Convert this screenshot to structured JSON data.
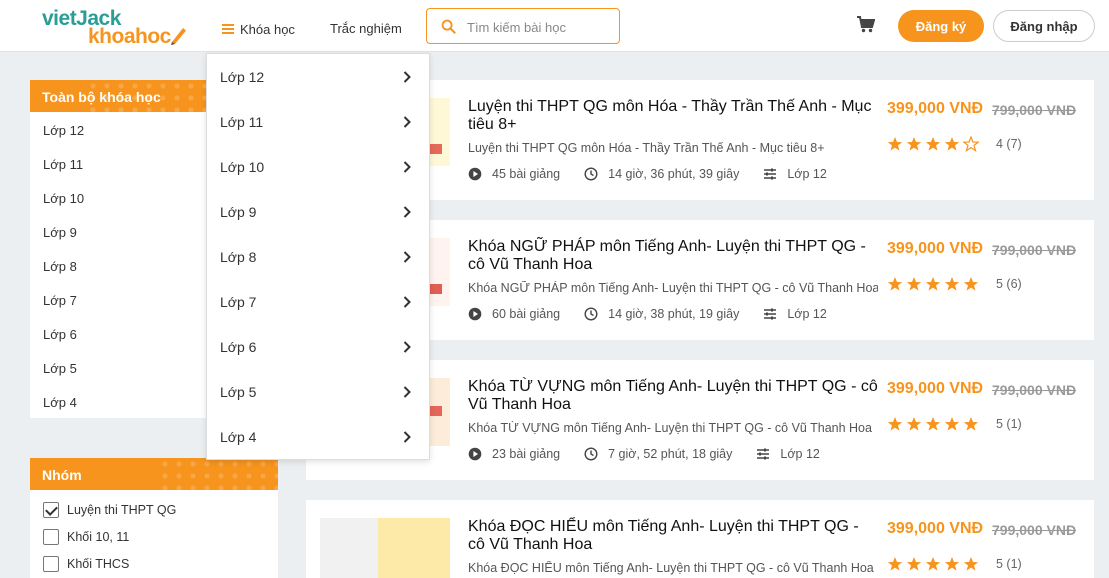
{
  "header": {
    "logo_top": "vietJack",
    "logo_bottom": "khoahoc",
    "nav_courses": "Khóa học",
    "nav_quiz": "Trắc nghiệm",
    "search_placeholder": "Tìm kiếm bài học",
    "register": "Đăng ký",
    "login": "Đăng nhập"
  },
  "dropdown": {
    "items": [
      "Lớp 12",
      "Lớp 11",
      "Lớp 10",
      "Lớp 9",
      "Lớp 8",
      "Lớp 7",
      "Lớp 6",
      "Lớp 5",
      "Lớp 4"
    ]
  },
  "sidebar": {
    "categories_title": "Toàn bộ khóa học",
    "categories": [
      "Lớp 12",
      "Lớp 11",
      "Lớp 10",
      "Lớp 9",
      "Lớp 8",
      "Lớp 7",
      "Lớp 6",
      "Lớp 5",
      "Lớp 4"
    ],
    "group_title": "Nhóm",
    "groups": [
      {
        "label": "Luyện thi THPT QG",
        "checked": true
      },
      {
        "label": "Khối 10, 11",
        "checked": false
      },
      {
        "label": "Khối THCS",
        "checked": false
      }
    ]
  },
  "courses": [
    {
      "title": "Luyện thi THPT QG môn Hóa - Thầy Trần Thế Anh - Mục tiêu 8+",
      "subtitle": "Luyện thi THPT QG môn Hóa - Thầy Trần Thế Anh - Mục tiêu 8+",
      "lessons": "45 bài giảng",
      "duration": "14 giờ, 36 phút, 39 giây",
      "grade": "Lớp 12",
      "price": "399,000 VNĐ",
      "old_price": "799,000 VNĐ",
      "stars": 4,
      "rating_text": "4 (7)"
    },
    {
      "title": "Khóa NGỮ PHÁP môn Tiếng Anh- Luyện thi THPT QG - cô Vũ Thanh Hoa",
      "subtitle": "Khóa NGỮ PHÁP môn Tiếng Anh- Luyện thi THPT QG - cô Vũ Thanh Hoa",
      "lessons": "60 bài giảng",
      "duration": "14 giờ, 38 phút, 19 giây",
      "grade": "Lớp 12",
      "price": "399,000 VNĐ",
      "old_price": "799,000 VNĐ",
      "stars": 5,
      "rating_text": "5 (6)"
    },
    {
      "title": "Khóa TỪ VỰNG môn Tiếng Anh- Luyện thi THPT QG - cô Vũ Thanh Hoa",
      "subtitle": "Khóa TỪ VỰNG môn Tiếng Anh- Luyện thi THPT QG - cô Vũ Thanh Hoa",
      "lessons": "23 bài giảng",
      "duration": "7 giờ, 52 phút, 18 giây",
      "grade": "Lớp 12",
      "price": "399,000 VNĐ",
      "old_price": "799,000 VNĐ",
      "stars": 5,
      "rating_text": "5 (1)"
    },
    {
      "title": "Khóa ĐỌC HIỂU môn Tiếng Anh- Luyện thi THPT QG - cô Vũ Thanh Hoa",
      "subtitle": "Khóa ĐỌC HIỂU môn Tiếng Anh- Luyện thi THPT QG - cô Vũ Thanh Hoa",
      "lessons": "",
      "duration": "",
      "grade": "",
      "price": "399,000 VNĐ",
      "old_price": "799,000 VNĐ",
      "stars": 5,
      "rating_text": "5 (1)"
    }
  ],
  "colors": {
    "accent": "#f7941d",
    "brand_teal": "#2a9e96",
    "background": "#eceff1"
  }
}
